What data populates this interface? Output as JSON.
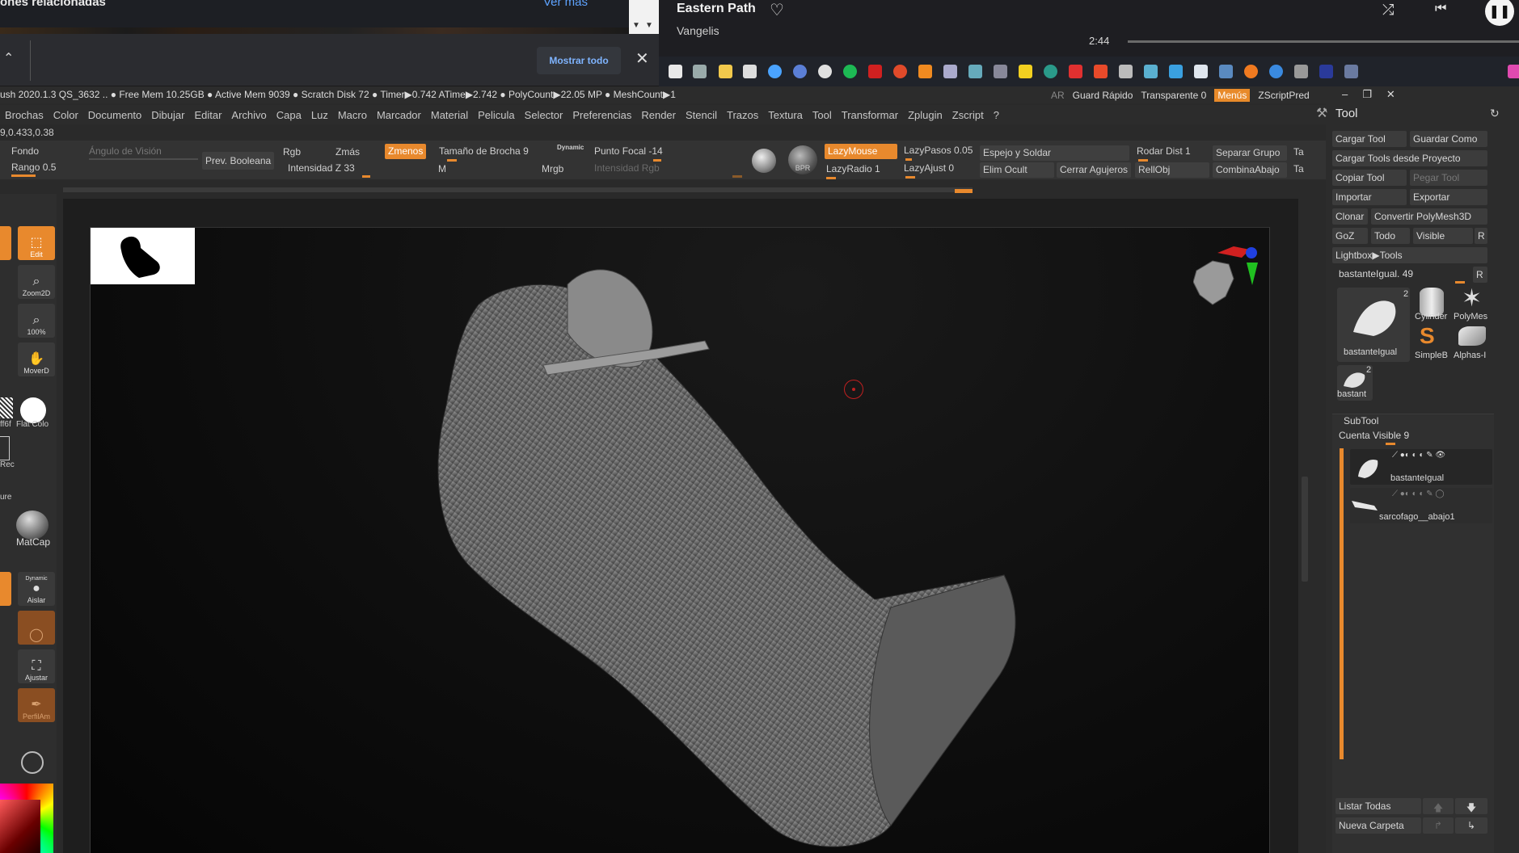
{
  "browser": {
    "related_title": "ones relacionadas",
    "ver_mas": "Ver más",
    "mostrar_todo": "Mostrar todo"
  },
  "media": {
    "song": "Eastern Path",
    "artist": "Vangelis",
    "time": "2:44",
    "progress": 0.0
  },
  "status": {
    "text": "ush 2020.1.3    QS_3632   .. ● Free Mem 10.25GB ● Active Mem 9039 ● Scratch Disk 72 ●  Timer▶0.742 ATime▶2.742 ● PolyCount▶22.05 MP  ● MeshCount▶1",
    "ar": "AR",
    "guard_rapido": "Guard Rápido",
    "transparente": "Transparente 0",
    "menus": "Menús",
    "zscriptpred": "ZScriptPred"
  },
  "menu": [
    "Brochas",
    "Color",
    "Documento",
    "Dibujar",
    "Editar",
    "Archivo",
    "Capa",
    "Luz",
    "Macro",
    "Marcador",
    "Material",
    "Pelicula",
    "Selector",
    "Preferencias",
    "Render",
    "Stencil",
    "Trazos",
    "Textura",
    "Tool",
    "Transformar",
    "Zplugin",
    "Zscript",
    "?"
  ],
  "coords": "9,0.433,0.38",
  "shelf": {
    "fondo": "Fondo",
    "rango": "Rango 0.5",
    "angulo": "Ángulo de Visión",
    "prev_booleana": "Prev. Booleana",
    "rgb": "Rgb",
    "zmas": "Zmás",
    "zmenos": "Zmenos",
    "tam_brocha": "Tamaño de Brocha 9",
    "dynamic": "Dynamic",
    "punto_focal": "Punto Focal -14",
    "intensidad_z": "Intensidad Z 33",
    "m": "M",
    "mrgb": "Mrgb",
    "intensidad_rgb": "Intensidad Rgb",
    "bpr": "BPR",
    "lazymouse": "LazyMouse",
    "lazypasos": "LazyPasos 0.05",
    "lazyradio": "LazyRadio 1",
    "lazyajust": "LazyAjust 0",
    "espejo": "Espejo y Soldar",
    "elim_ocult": "Elim Ocult",
    "cerrar_agujeros": "Cerrar Agujeros",
    "rodar_dist": "Rodar Dist 1",
    "rellobj": "RellObj",
    "separar_grupo": "Separar Grupo",
    "combina_abajo": "CombinaAbajo",
    "ta1": "Ta",
    "ta2": "Ta"
  },
  "left_tools": {
    "edit": "Edit",
    "zoom2d": "Zoom2D",
    "pct100": "100%",
    "moverd": "MoverD",
    "flat_color": "Flat Colo",
    "ff": "ff6f",
    "rec": "Rec",
    "ure": "ure",
    "matcap": "MatCap",
    "dynamic": "Dynamic",
    "aislar": "Aislar",
    "ajustar": "Ajustar",
    "perfil": "PerfilAm"
  },
  "tool_panel": {
    "title": "Tool",
    "cargar_tool": "Cargar Tool",
    "guardar_como": "Guardar Como",
    "cargar_proyecto": "Cargar Tools desde Proyecto",
    "copiar_tool": "Copiar Tool",
    "pegar_tool": "Pegar Tool",
    "importar": "Importar",
    "exportar": "Exportar",
    "clonar": "Clonar",
    "convertir": "Convertir PolyMesh3D",
    "goz": "GoZ",
    "todo": "Todo",
    "visible": "Visible",
    "r": "R",
    "lightbox": "Lightbox▶Tools",
    "current_tool": "bastanteIgual. 49",
    "r2": "R",
    "thumb_main": "bastanteIgual",
    "thumb_main_count": "2",
    "cylinder": "Cylinder",
    "polymesh": "PolyMes",
    "simpleb": "SimpleB",
    "alphas": "Alphas-I",
    "thumb_small": "bastant",
    "thumb_small_count": "2"
  },
  "subtool": {
    "title": "SubTool",
    "cuenta_visible": "Cuenta Visible 9",
    "items": [
      "bastanteIgual",
      "sarcofago__abajo1"
    ],
    "listar_todas": "Listar Todas",
    "nueva_carpeta": "Nueva Carpeta"
  },
  "colors": {
    "accent": "#e8892d",
    "bg": "#2c2c2c"
  }
}
